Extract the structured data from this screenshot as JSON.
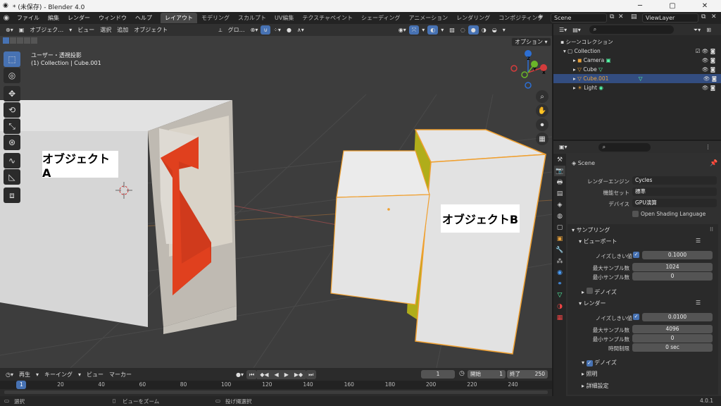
{
  "window": {
    "title": "* (未保存) - Blender 4.0",
    "minimize": "─",
    "maximize": "▢",
    "close": "✕"
  },
  "menubar": {
    "menus": [
      "ファイル",
      "編集",
      "レンダー",
      "ウィンドウ",
      "ヘルプ"
    ],
    "workspaces": [
      "レイアウト",
      "モデリング",
      "スカルプト",
      "UV編集",
      "テクスチャペイント",
      "シェーディング",
      "アニメーション",
      "レンダリング",
      "コンポジティング"
    ],
    "scene": "Scene",
    "view_layer": "ViewLayer"
  },
  "viewport": {
    "mode": "オブジェク…",
    "menus": [
      "ビュー",
      "選択",
      "追加",
      "オブジェクト"
    ],
    "orientation": "グロ…",
    "options": "オプション",
    "info_line1": "ユーザー・透視投影",
    "info_line2": "(1) Collection | Cube.001",
    "label_a": "オブジェクトA",
    "label_b": "オブジェクトB",
    "gizmo": {
      "x": "X",
      "y": "Y",
      "z": "Z"
    }
  },
  "timeline": {
    "menus": [
      "再生",
      "キーイング",
      "ビュー",
      "マーカー"
    ],
    "current_frame": "1",
    "start_label": "開始",
    "start": "1",
    "end_label": "終了",
    "end": "250",
    "ticks": [
      "1",
      "20",
      "40",
      "60",
      "80",
      "100",
      "120",
      "140",
      "160",
      "180",
      "200",
      "220",
      "240"
    ]
  },
  "statusbar": {
    "select": "選択",
    "zoom": "ビューをズーム",
    "lasso": "投げ縄選択",
    "version": "4.0.1"
  },
  "outliner": {
    "root": "シーンコレクション",
    "collection": "Collection",
    "items": [
      "Camera",
      "Cube",
      "Cube.001",
      "Light"
    ]
  },
  "properties": {
    "scene": "Scene",
    "render_engine_label": "レンダーエンジン",
    "render_engine": "Cycles",
    "feature_set_label": "機能セット",
    "feature_set": "標準",
    "device_label": "デバイス",
    "device": "GPU演算",
    "osl": "Open Shading Language",
    "sampling": "サンプリング",
    "viewport_panel": "ビューポート",
    "noise_threshold_label": "ノイズしきい値",
    "vp_noise": "0.1000",
    "max_samples_label": "最大サンプル数",
    "vp_max": "1024",
    "min_samples_label": "最小サンプル数",
    "vp_min": "0",
    "denoise": "デノイズ",
    "render_panel": "レンダー",
    "r_noise": "0.0100",
    "r_max": "4096",
    "r_min": "0",
    "time_limit_label": "時間制限",
    "r_time": "0 sec",
    "light_paths": "照明",
    "advanced": "詳細設定"
  }
}
